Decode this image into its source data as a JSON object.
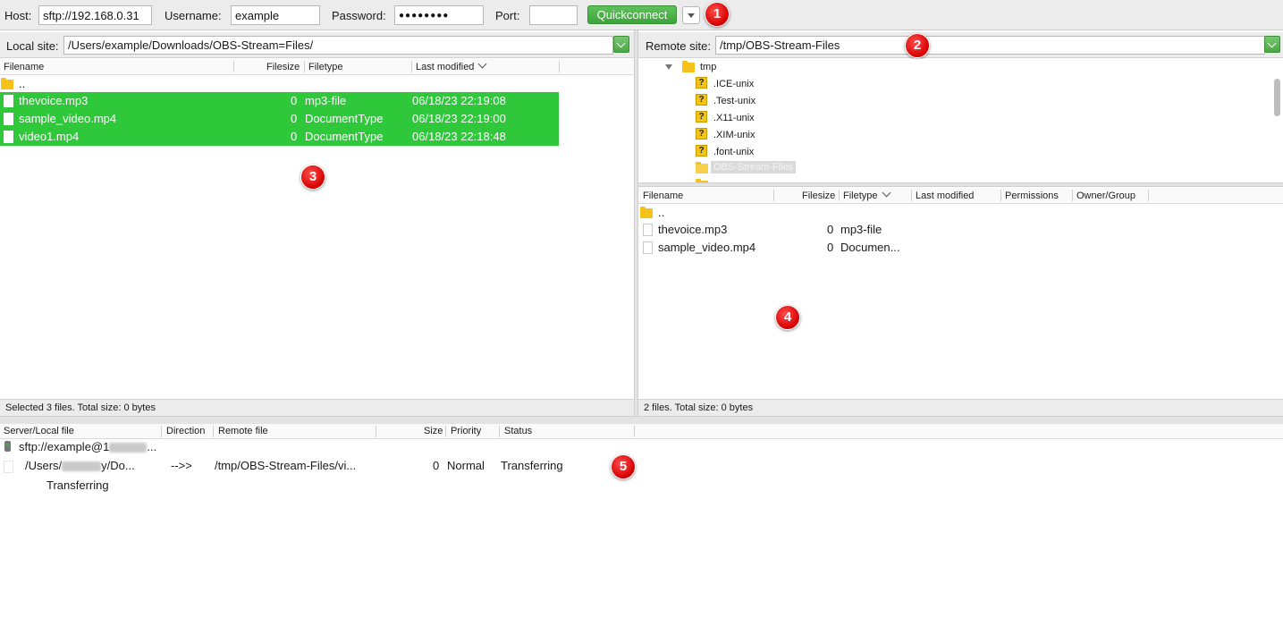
{
  "toolbar": {
    "host_label": "Host:",
    "host_value": "sftp://192.168.0.31",
    "username_label": "Username:",
    "username_value": "example",
    "password_label": "Password:",
    "password_value": "●●●●●●●●",
    "port_label": "Port:",
    "port_value": "",
    "quickconnect_label": "Quickconnect"
  },
  "callouts": [
    "1",
    "2",
    "3",
    "4",
    "5"
  ],
  "local": {
    "site_label": "Local site:",
    "site_path": "/Users/example/Downloads/OBS-Stream=Files/",
    "columns": [
      "Filename",
      "Filesize",
      "Filetype",
      "Last modified"
    ],
    "parent": "..",
    "files": [
      {
        "name": "thevoice.mp3",
        "size": "0",
        "type": "mp3-file",
        "modified": "06/18/23 22:19:08"
      },
      {
        "name": "sample_video.mp4",
        "size": "0",
        "type": "DocumentType",
        "modified": "06/18/23 22:19:00"
      },
      {
        "name": "video1.mp4",
        "size": "0",
        "type": "DocumentType",
        "modified": "06/18/23 22:18:48"
      }
    ],
    "status": "Selected 3 files. Total size: 0 bytes"
  },
  "remote": {
    "site_label": "Remote site:",
    "site_path": "/tmp/OBS-Stream-Files",
    "tree": {
      "root": "tmp",
      "children": [
        ".ICE-unix",
        ".Test-unix",
        ".X11-unix",
        ".XIM-unix",
        ".font-unix"
      ],
      "selected": "OBS-Stream-Files"
    },
    "columns": [
      "Filename",
      "Filesize",
      "Filetype",
      "Last modified",
      "Permissions",
      "Owner/Group"
    ],
    "parent": "..",
    "files": [
      {
        "name": "thevoice.mp3",
        "size": "0",
        "type": "mp3-file"
      },
      {
        "name": "sample_video.mp4",
        "size": "0",
        "type": "Documen..."
      }
    ],
    "status": "2 files. Total size: 0 bytes"
  },
  "queue": {
    "columns": [
      "Server/Local file",
      "Direction",
      "Remote file",
      "Size",
      "Priority",
      "Status"
    ],
    "server_prefix": "sftp://example@1",
    "server_suffix": "...",
    "local_prefix": "/Users/",
    "local_suffix": "y/Do...",
    "direction": "-->>",
    "remote_file": "/tmp/OBS-Stream-Files/vi...",
    "size": "0",
    "priority": "Normal",
    "status": "Transferring",
    "progress_text": "Transferring"
  }
}
